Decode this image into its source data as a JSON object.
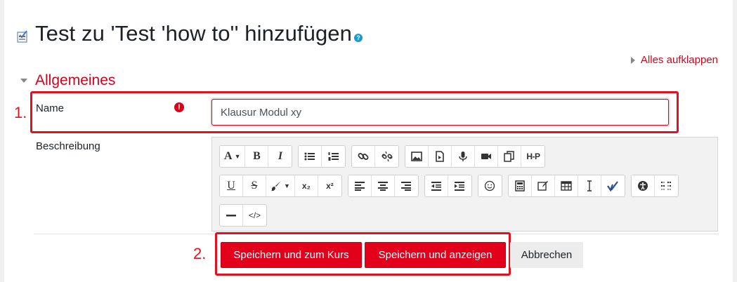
{
  "header": {
    "title": "Test zu 'Test 'how to'' hinzufügen",
    "help_icon": "?"
  },
  "expand_all": {
    "label": "Alles aufklappen"
  },
  "section": {
    "title": "Allgemeines"
  },
  "annotations": {
    "one": "1.",
    "two": "2."
  },
  "form": {
    "name_label": "Name",
    "required_icon": "!",
    "name_value": "Klausur Modul xy",
    "description_label": "Beschreibung"
  },
  "toolbar": {
    "font_label": "A",
    "bold": "B",
    "italic": "I",
    "underline": "U",
    "strike": "S",
    "subscript": "x₂",
    "superscript": "x²",
    "h5p": "H-P",
    "html": "</>"
  },
  "buttons": {
    "save_return": "Speichern und zum Kurs",
    "save_display": "Speichern und anzeigen",
    "cancel": "Abbrechen"
  },
  "colors": {
    "accent": "#d9001a",
    "annotation": "#e4101e",
    "button_primary": "#e2001a"
  }
}
